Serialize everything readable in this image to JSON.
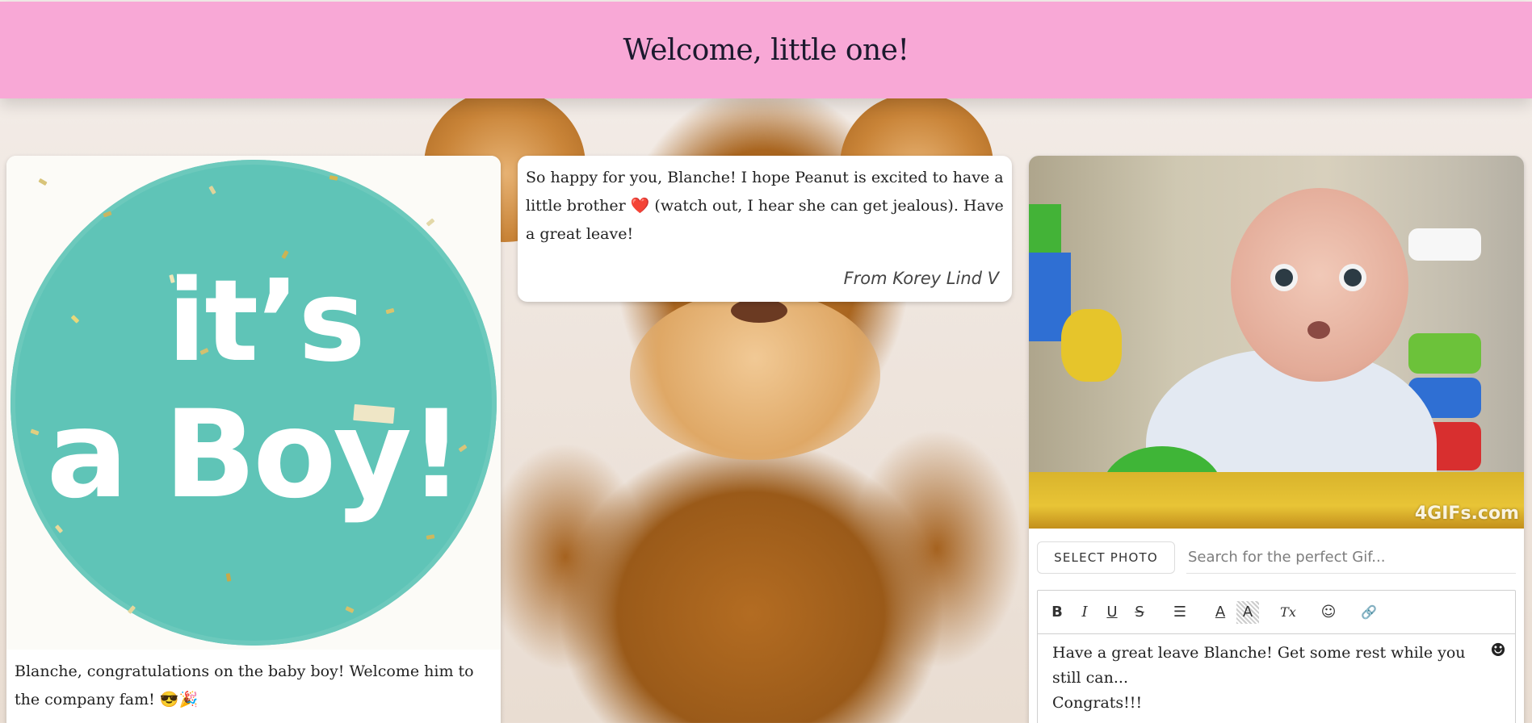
{
  "header": {
    "title": "Welcome, little one!"
  },
  "posts": {
    "boy_card": {
      "image_line1": "it’s",
      "image_line2": "a Boy!",
      "caption": "Blanche, congratulations on the baby boy! Welcome him to the company fam! 😎🎉"
    },
    "message_card": {
      "text_before_heart": "So happy for you, Blanche! I hope Peanut is excited to have a little brother ",
      "heart": "❤️",
      "text_after_heart": " (watch out, I hear she can get jealous). Have a great leave!",
      "signature": "From Korey Lind V"
    }
  },
  "composer": {
    "gif_watermark": "4GIFs.com",
    "select_photo_label": "SELECT PHOTO",
    "gif_search_placeholder": "Search for the perfect Gif...",
    "toolbar": {
      "bold": "B",
      "italic": "I",
      "underline": "U",
      "strike": "S",
      "list": "☰",
      "font_color": "A",
      "highlight": "A",
      "clear_format": "Tx",
      "emoji": "☺",
      "link": "🔗"
    },
    "body_line1": "Have a great leave Blanche! Get some rest while you still can...",
    "body_line2": "Congrats!!!",
    "emoji_button": "☻"
  },
  "colors": {
    "header_bg": "#f8a8d6",
    "boy_circle": "#5fc4b7",
    "heart": "#d9302c"
  }
}
